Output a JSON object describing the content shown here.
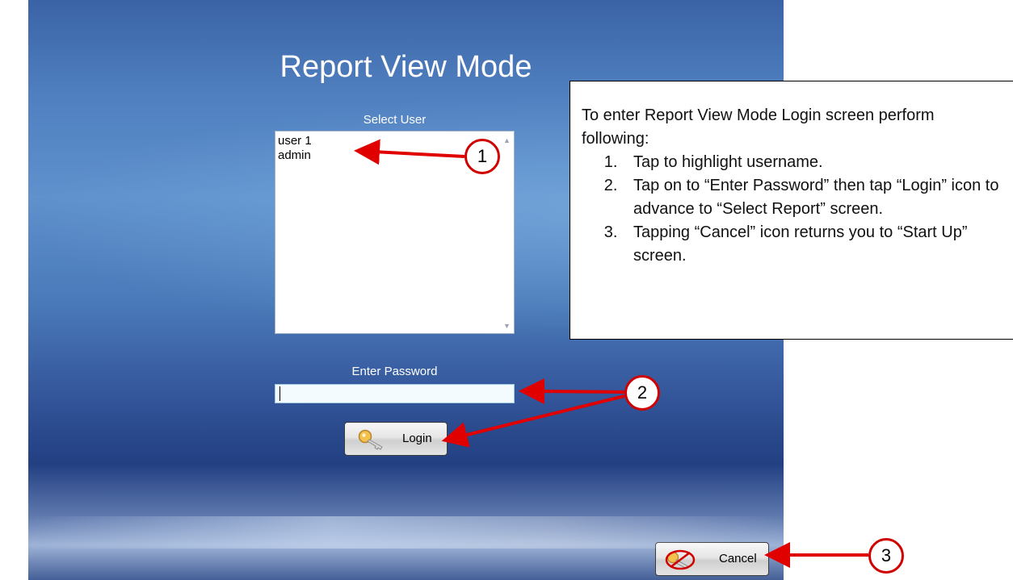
{
  "screen": {
    "title": "Report View Mode",
    "select_user_label": "Select User",
    "users": [
      "user 1",
      "admin"
    ],
    "password_label": "Enter Password",
    "password_value": "",
    "login_button": "Login",
    "cancel_button": "Cancel",
    "icons": {
      "login": "key-icon",
      "cancel": "key-prohibited-icon"
    }
  },
  "callout": {
    "intro": "To enter Report View Mode Login screen perform following:",
    "steps": [
      "Tap to highlight username.",
      "Tap on to “Enter Password” then tap “Login” icon to advance to “Select Report” screen.",
      "Tapping “Cancel” icon returns you to “Start Up” screen."
    ]
  },
  "markers": [
    "1",
    "2",
    "3"
  ],
  "colors": {
    "marker_red": "#d00000",
    "background_blue": "#3a63a5"
  }
}
